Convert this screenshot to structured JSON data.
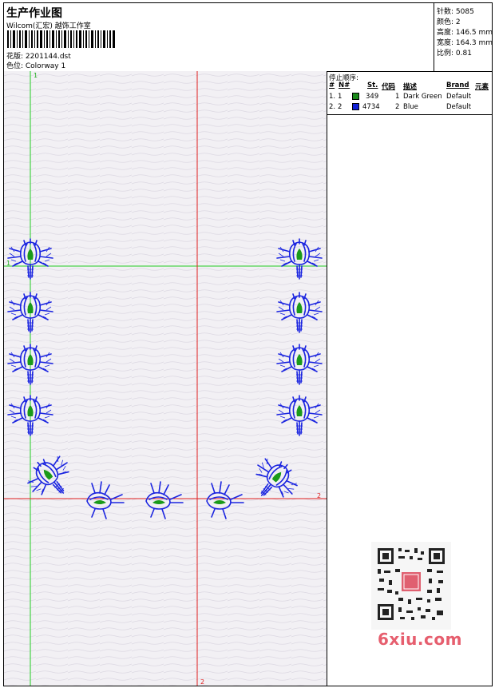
{
  "header": {
    "title": "生产作业图",
    "company": "Wilcom(汇宏) 越饰工作室",
    "design_label": "花版: 2201144.dst",
    "color_label": "色位: Colorway 1"
  },
  "stats": {
    "stitches": "针数: 5085",
    "colors": "颜色: 2",
    "height": "高度: 146.5 mm",
    "width": "宽度: 164.3 mm",
    "scale": "比例: 0.81"
  },
  "stop_sequence": {
    "title": "停止顺序:",
    "columns": [
      "#",
      "N#",
      "St.",
      "代码",
      "描述",
      "Brand",
      "元素"
    ],
    "rows": [
      {
        "idx": "1.",
        "n": "1",
        "st": "349",
        "code": "1",
        "desc": "Dark Green",
        "brand": "Default",
        "color": "#1a8a1a"
      },
      {
        "idx": "2.",
        "n": "2",
        "st": "4734",
        "code": "2",
        "desc": "Blue",
        "brand": "Default",
        "color": "#1020d8"
      }
    ]
  },
  "axes": {
    "v_green": "1",
    "h_green": "1",
    "v_red": "2",
    "h_red": "2"
  },
  "watermark": "6xiu.com",
  "colors": {
    "thread_blue": "#1a24e0",
    "thread_green": "#1a9a1a",
    "guide_green": "#22cc22",
    "guide_red": "#e02020"
  }
}
